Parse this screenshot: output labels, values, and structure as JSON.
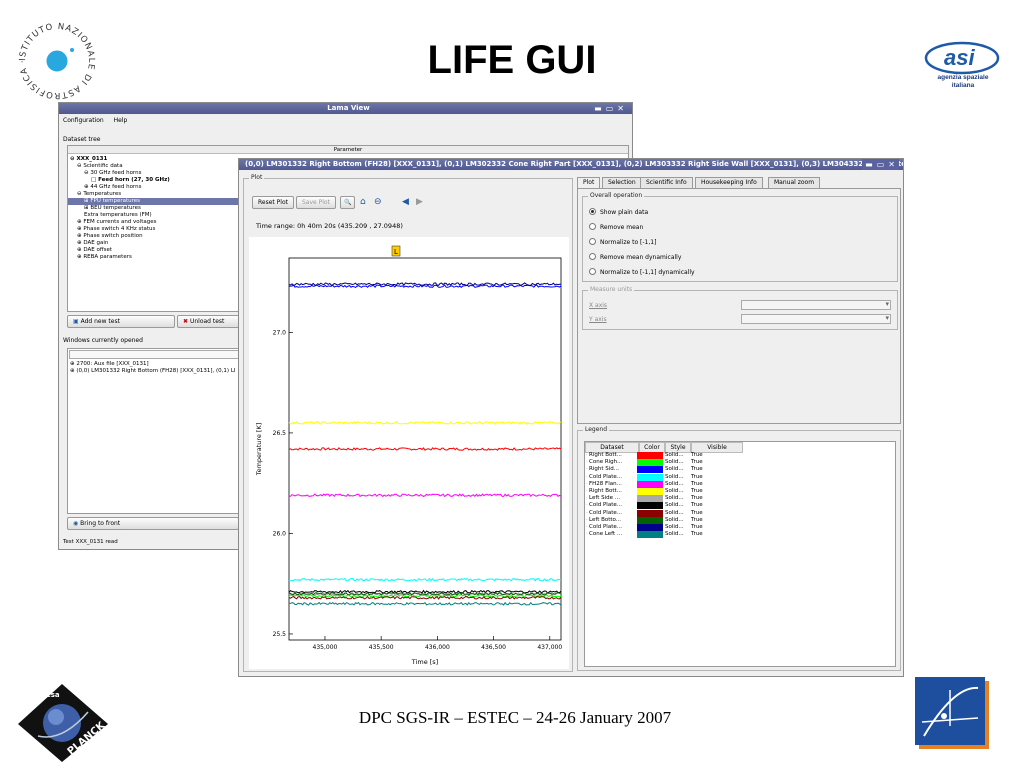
{
  "slide": {
    "title": "LIFE GUI",
    "footer": "DPC SGS-IR – ESTEC – 24-26 January 2007",
    "inaf_logo_text": "ISTITUTO NAZIONALE DI ASTROFISICA · INAF ·",
    "asi_logo_text": "asi",
    "asi_logo_sub": "agenzia spaziale italiana",
    "planck_logo_text": "PLANCK",
    "planck_esa_text": "esa"
  },
  "lama": {
    "title": "Lama View",
    "menu": [
      "Configuration",
      "Help"
    ],
    "dataset_tree_label": "Dataset tree",
    "param_header": "Parameter",
    "tree": [
      {
        "depth": 0,
        "toggle": "⊖",
        "label": "XXX_0131",
        "bold": true
      },
      {
        "depth": 1,
        "toggle": "⊖",
        "label": "Scientific data"
      },
      {
        "depth": 2,
        "toggle": "⊖",
        "label": "30 GHz feed horns"
      },
      {
        "depth": 3,
        "toggle": "□",
        "label": "Feed horn (27, 30 GHz)",
        "bold": true
      },
      {
        "depth": 2,
        "toggle": "⊕",
        "label": "44 GHz feed horns"
      },
      {
        "depth": 1,
        "toggle": "⊖",
        "label": "Temperatures"
      },
      {
        "depth": 2,
        "toggle": "⊞",
        "label": "FPU temperatures",
        "selected": true
      },
      {
        "depth": 2,
        "toggle": "⊞",
        "label": "BEU temperatures"
      },
      {
        "depth": 2,
        "toggle": "",
        "label": "Extra temperatures (FM)"
      },
      {
        "depth": 1,
        "toggle": "⊕",
        "label": "FEM currents and voltages"
      },
      {
        "depth": 1,
        "toggle": "⊕",
        "label": "Phase switch 4 KHz status"
      },
      {
        "depth": 1,
        "toggle": "⊕",
        "label": "Phase switch position"
      },
      {
        "depth": 1,
        "toggle": "⊕",
        "label": "DAE gain"
      },
      {
        "depth": 1,
        "toggle": "⊕",
        "label": "DAE offset"
      },
      {
        "depth": 1,
        "toggle": "⊕",
        "label": "REBA parameters"
      }
    ],
    "add_test": "Add new test",
    "unload_test": "Unload test",
    "windows_label": "Windows currently opened",
    "windows": [
      "2700: Aux file [XXX_0131]",
      "(0,0) LM301332 Right Bottom (FH28) [XXX_0131], (0,1) LI"
    ],
    "bring_front": "Bring to front",
    "status": "Test XXX_0131 read"
  },
  "plotwin": {
    "title": "(0,0) LM301332 Right Bottom (FH28) [XXX_0131], (0,1) LM302332 Cone Right Part [XXX_0131], (0,2) LM303332 Right Side Wall [XXX_0131], (0,3) LM304332 Cold Plate Far Righ",
    "plot_group": "Plot",
    "reset_plot": "Reset Plot",
    "save_plot": "Save Plot",
    "time_range": "Time range: 0h 40m 20s (435.209 , 27.0948)",
    "marker_label": "L",
    "tabs": [
      "Plot",
      "Selection",
      "Scientific Info",
      "Housekeeping Info",
      "Manual zoom"
    ],
    "overall_operation": "Overall operation",
    "options": [
      "Show plain data",
      "Remove mean",
      "Normalize to [-1,1]",
      "Remove mean dynamically",
      "Normalize to [-1,1] dynamically"
    ],
    "selected_option": 0,
    "measure_units": "Measure units",
    "x_axis": "X axis",
    "y_axis": "Y axis",
    "legend_group": "Legend",
    "legend_headers": [
      "Dataset",
      "Color",
      "Style",
      "Visible"
    ]
  },
  "chart_data": {
    "type": "line",
    "xlabel": "Time [s]",
    "ylabel": "Temperature [K]",
    "xlim": [
      434680,
      437100
    ],
    "ylim": [
      25.47,
      27.37
    ],
    "xticks": [
      435000,
      435500,
      436000,
      436500,
      437000
    ],
    "xtick_labels": [
      "435,000",
      "435,500",
      "436,000",
      "436,500",
      "437,000"
    ],
    "yticks": [
      25.5,
      26.0,
      26.5,
      27.0
    ],
    "ytick_labels": [
      "25.5",
      "26.0",
      "26.5",
      "27.0"
    ],
    "grid": false,
    "series": [
      {
        "name": "Right Bott...",
        "color": "#ff0000",
        "style": "Solid...",
        "visible": "True",
        "y": 26.42
      },
      {
        "name": "Cone Righ...",
        "color": "#00ff00",
        "style": "Solid...",
        "visible": "True",
        "y": 25.69
      },
      {
        "name": "Right Sid...",
        "color": "#0000ff",
        "style": "Solid...",
        "visible": "True",
        "y": 27.23
      },
      {
        "name": "Cold Plate...",
        "color": "#00ffff",
        "style": "Solid...",
        "visible": "True",
        "y": 25.77
      },
      {
        "name": "FH28 Flan...",
        "color": "#ff00ff",
        "style": "Solid...",
        "visible": "True",
        "y": 26.19
      },
      {
        "name": "Right Bott...",
        "color": "#ffff00",
        "style": "Solid...",
        "visible": "True",
        "y": 26.55
      },
      {
        "name": "Left Side ...",
        "color": "#aaaaaa",
        "style": "Solid...",
        "visible": "True",
        "y": 25.7
      },
      {
        "name": "Cold Plate...",
        "color": "#000000",
        "style": "Solid...",
        "visible": "True",
        "y": 25.71
      },
      {
        "name": "Cold Plate...",
        "color": "#8b0000",
        "style": "Solid...",
        "visible": "True",
        "y": 25.68
      },
      {
        "name": "Left Botto...",
        "color": "#006400",
        "style": "Solid...",
        "visible": "True",
        "y": 25.7
      },
      {
        "name": "Cold Plate...",
        "color": "#00008b",
        "style": "Solid...",
        "visible": "True",
        "y": 27.24
      },
      {
        "name": "Cone Left ...",
        "color": "#008080",
        "style": "Solid...",
        "visible": "True",
        "y": 25.65
      }
    ]
  }
}
